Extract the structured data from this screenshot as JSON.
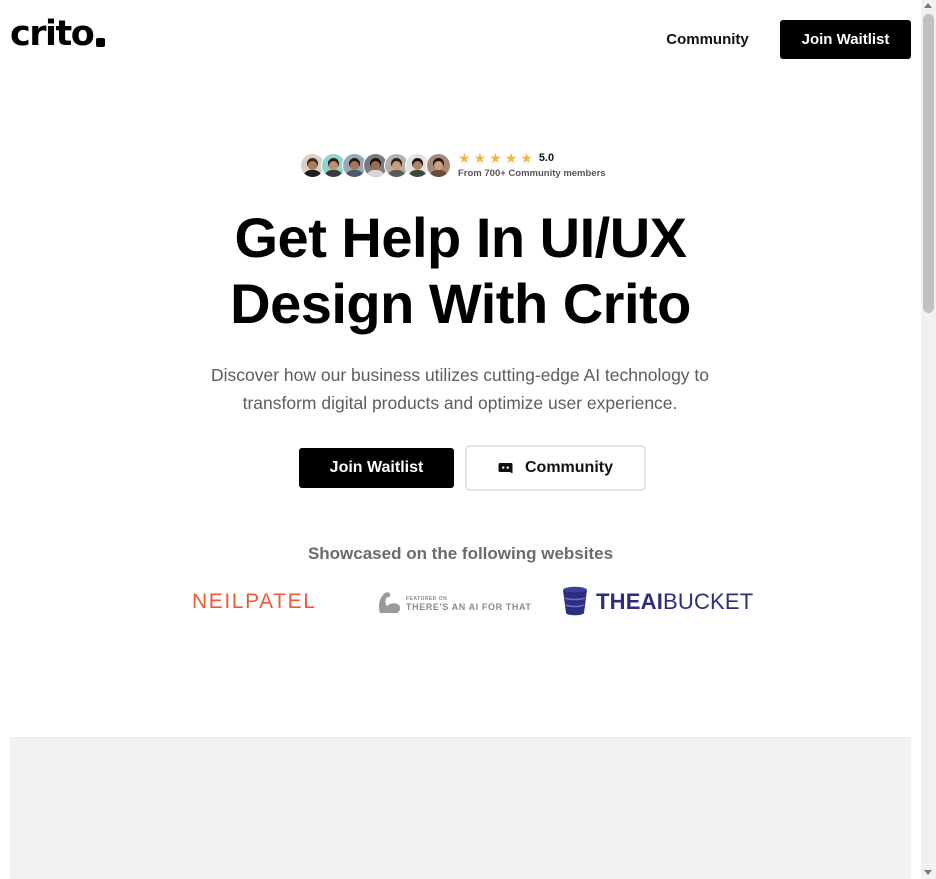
{
  "header": {
    "logo": "crito",
    "nav_community": "Community",
    "nav_join": "Join Waitlist"
  },
  "social_proof": {
    "avatar_count": 7,
    "stars": 5,
    "rating": "5.0",
    "members": "From 700+ Community members"
  },
  "hero": {
    "title_line1": "Get Help In UI/UX",
    "title_line2": "Design With Crito",
    "subtitle_line1": "Discover how our business utilizes cutting-edge AI technology to",
    "subtitle_line2": "transform digital products and optimize user experience.",
    "cta_join": "Join Waitlist",
    "cta_community": "Community",
    "community_icon": "discord-icon"
  },
  "showcase": {
    "heading": "Showcased on the following websites",
    "brands": {
      "neilpatel": "NEILPATEL",
      "aift_small": "FEATURED ON",
      "aift_big": "THERE'S AN AI FOR THAT",
      "aibucket_bold": "THEAI",
      "aibucket_light": "BUCKET"
    }
  },
  "colors": {
    "accent": "#000000",
    "subtitle": "#5d5d5d",
    "star": "#f4b63f",
    "neilpatel": "#ee5a32",
    "aibucket": "#2d2e7e",
    "preview_bg": "#f2f2f2"
  }
}
